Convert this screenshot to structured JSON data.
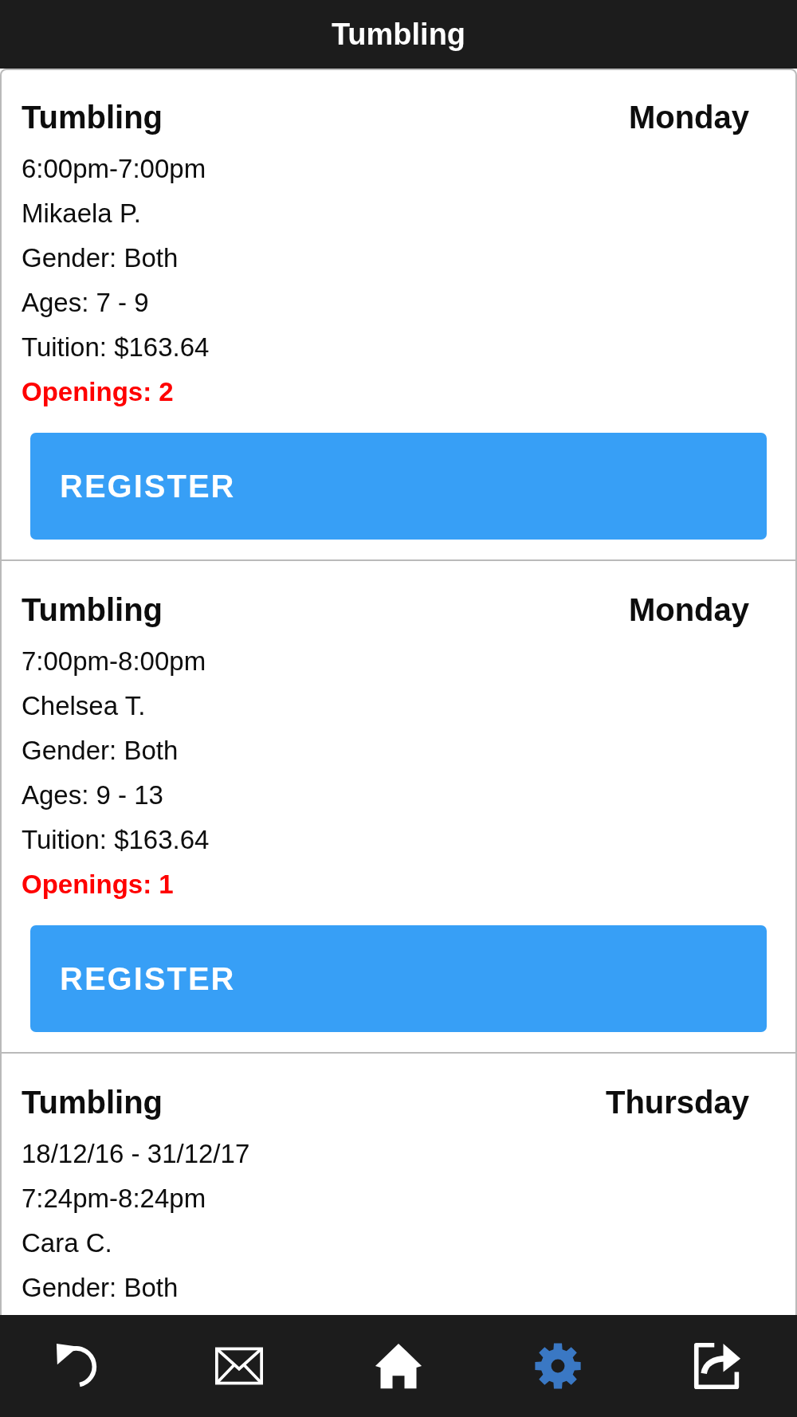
{
  "header": {
    "title": "Tumbling"
  },
  "classes": [
    {
      "name": "Tumbling",
      "day": "Monday",
      "lines": [
        {
          "kind": "detail",
          "text": "6:00pm-7:00pm"
        },
        {
          "kind": "detail",
          "text": "Mikaela P."
        },
        {
          "kind": "detail",
          "text": "Gender: Both"
        },
        {
          "kind": "detail",
          "text": "Ages: 7 - 9"
        },
        {
          "kind": "detail",
          "text": "Tuition: $163.64"
        },
        {
          "kind": "openings",
          "text": "Openings: 2"
        }
      ],
      "register": "REGISTER"
    },
    {
      "name": "Tumbling",
      "day": "Monday",
      "lines": [
        {
          "kind": "detail",
          "text": "7:00pm-8:00pm"
        },
        {
          "kind": "detail",
          "text": "Chelsea T."
        },
        {
          "kind": "detail",
          "text": "Gender: Both"
        },
        {
          "kind": "detail",
          "text": "Ages: 9 - 13"
        },
        {
          "kind": "detail",
          "text": "Tuition: $163.64"
        },
        {
          "kind": "openings",
          "text": "Openings: 1"
        }
      ],
      "register": "REGISTER"
    },
    {
      "name": "Tumbling",
      "day": "Thursday",
      "lines": [
        {
          "kind": "detail",
          "text": "18/12/16 - 31/12/17"
        },
        {
          "kind": "detail",
          "text": "7:24pm-8:24pm"
        },
        {
          "kind": "detail",
          "text": "Cara C."
        },
        {
          "kind": "detail",
          "text": "Gender: Both"
        }
      ]
    }
  ],
  "nav": [
    {
      "kind": "undo",
      "selected": false
    },
    {
      "kind": "mail",
      "selected": false
    },
    {
      "kind": "home",
      "selected": false
    },
    {
      "kind": "settings",
      "selected": true
    },
    {
      "kind": "share",
      "selected": false
    }
  ]
}
